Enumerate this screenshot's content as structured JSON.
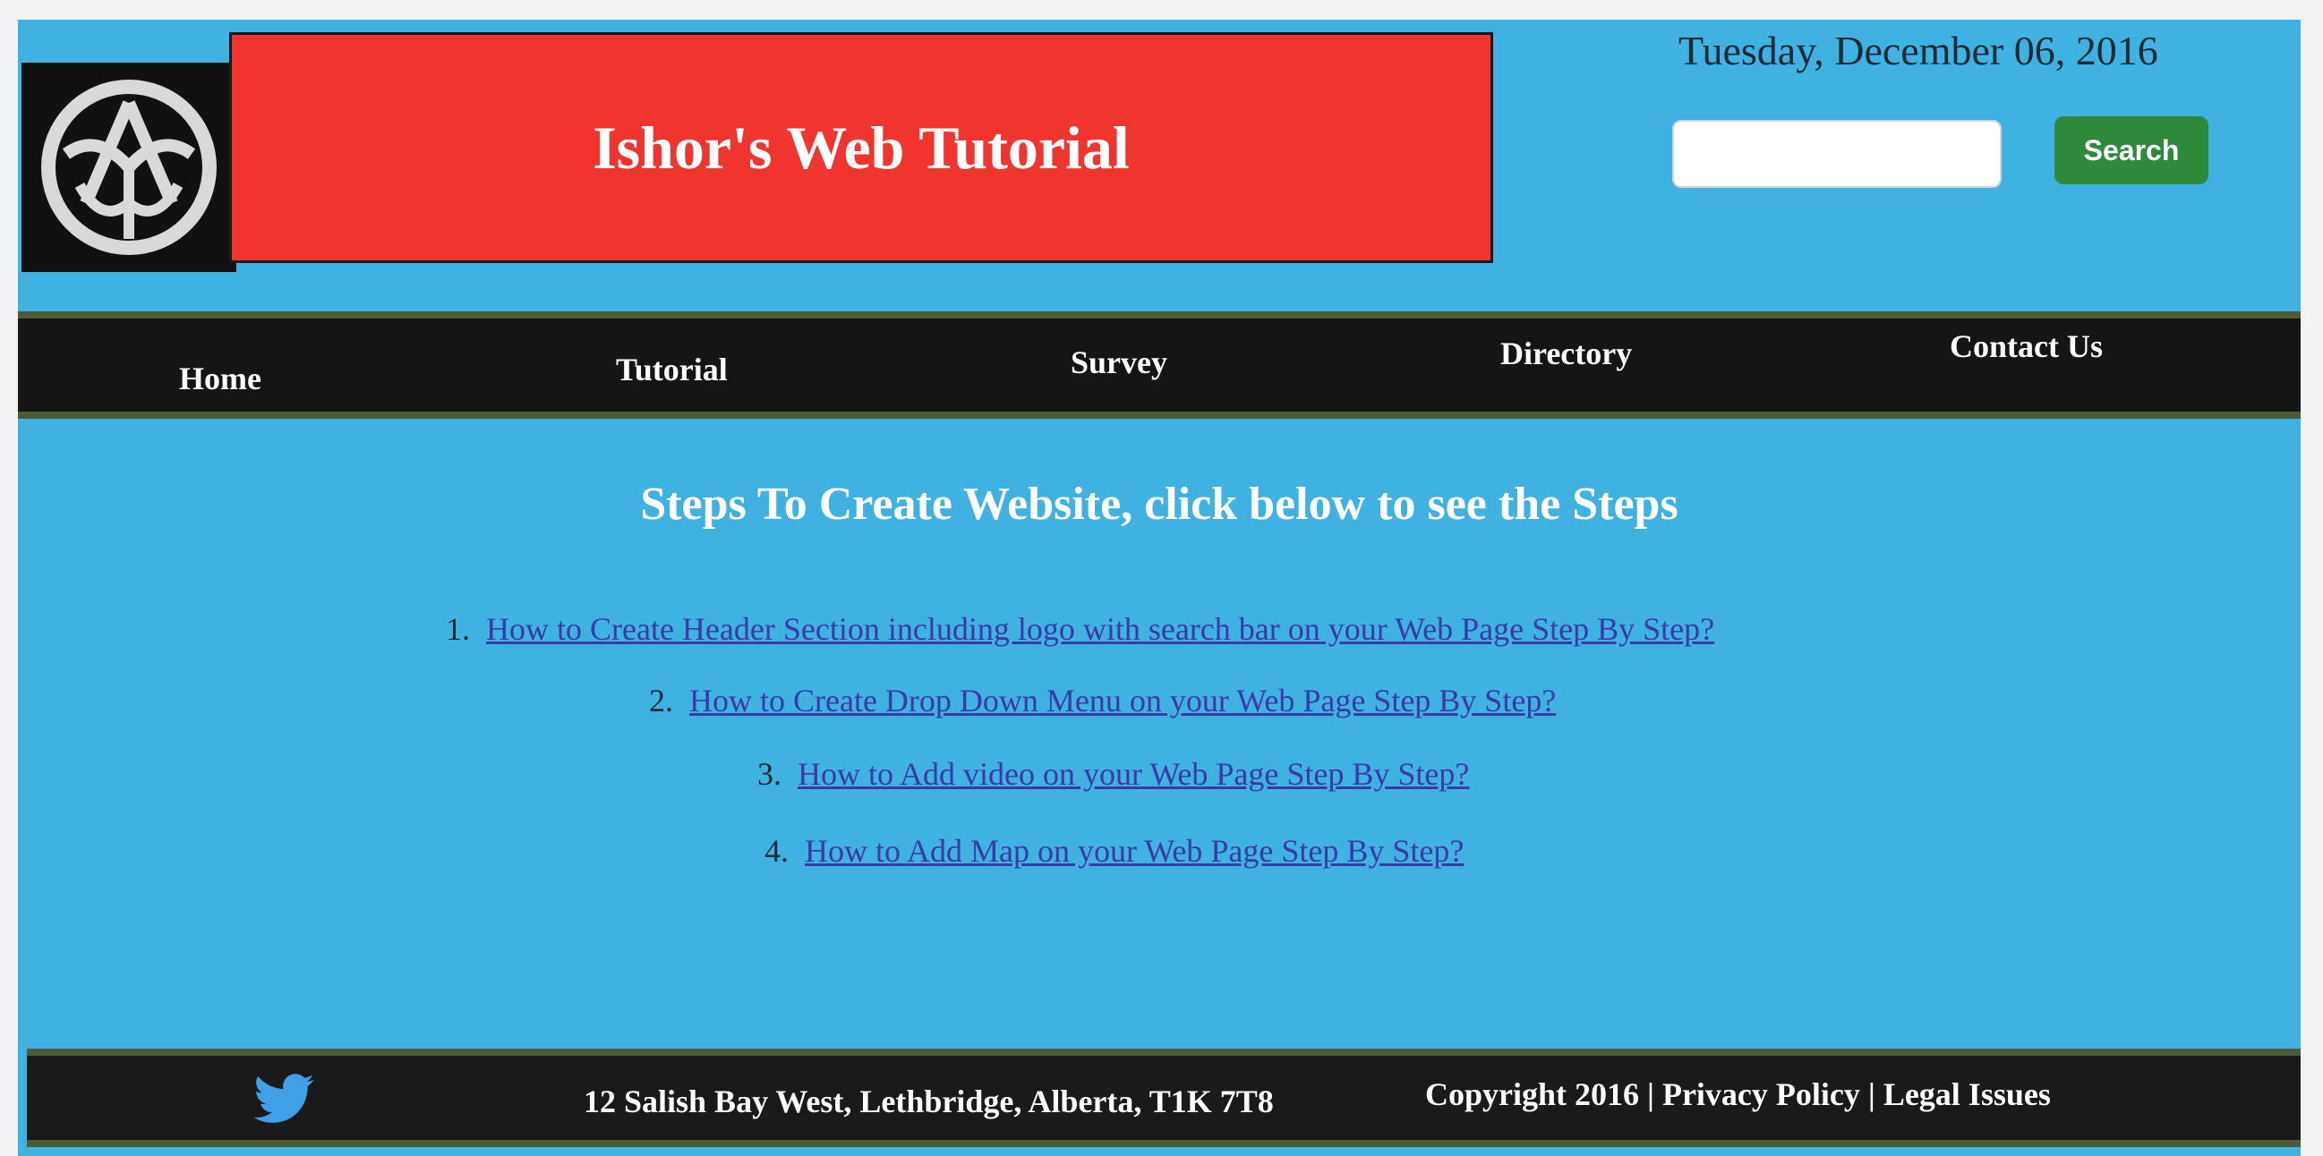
{
  "header": {
    "title": "Ishor's Web Tutorial",
    "date": "Tuesday, December 06, 2016",
    "logo_icon": "emblem-logo-icon",
    "search": {
      "placeholder": "",
      "value": "",
      "button_label": "Search"
    },
    "colors": {
      "banner": "#f0342e",
      "page_background": "#3fb2e2",
      "search_button": "#2e8a3a"
    }
  },
  "nav": {
    "items": [
      {
        "label": "Home"
      },
      {
        "label": "Tutorial"
      },
      {
        "label": "Survey"
      },
      {
        "label": "Directory"
      },
      {
        "label": "Contact Us"
      }
    ]
  },
  "main": {
    "heading": "Steps To Create Website, click below to see the Steps",
    "steps": [
      {
        "number": "1.",
        "text": "How to Create Header Section including logo with search bar on your Web Page Step By Step?"
      },
      {
        "number": "2.",
        "text": "How to Create Drop Down Menu on your Web Page Step By Step?"
      },
      {
        "number": "3.",
        "text": "How to Add video on your Web Page Step By Step?"
      },
      {
        "number": "4.",
        "text": "How to Add Map on your Web Page Step By Step?"
      }
    ]
  },
  "footer": {
    "social_icon": "twitter-bird-icon",
    "address": "12 Salish Bay West, Lethbridge, Alberta, T1K 7T8",
    "copyright": "Copyright 2016",
    "separator": "|",
    "privacy_label": "Privacy Policy",
    "legal_label": "Legal Issues"
  }
}
